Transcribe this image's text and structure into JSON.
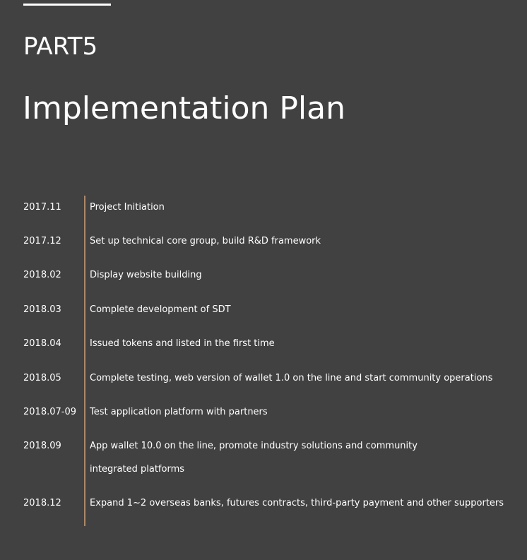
{
  "header": {
    "part_label": "PART5",
    "title": "Implementation Plan"
  },
  "timeline": {
    "accent_color": "#b7865a",
    "items": [
      {
        "date": "2017.11",
        "text": "Project Initiation"
      },
      {
        "date": "2017.12",
        "text": "Set up technical core group, build R&D framework"
      },
      {
        "date": "2018.02",
        "text": "Display website building"
      },
      {
        "date": "2018.03",
        "text": "Complete development of SDT"
      },
      {
        "date": "2018.04",
        "text": "Issued tokens and listed in the first time"
      },
      {
        "date": "2018.05",
        "text": "Complete testing, web version of wallet 1.0 on the line and start community operations"
      },
      {
        "date": "2018.07-09",
        "text": "Test application platform with partners"
      },
      {
        "date": "2018.09",
        "text": "App wallet 10.0 on the line, promote industry solutions and community integrated platforms"
      },
      {
        "date": "2018.12",
        "text": "Expand 1~2 overseas banks, futures contracts, third-party payment and other supporters"
      }
    ]
  }
}
